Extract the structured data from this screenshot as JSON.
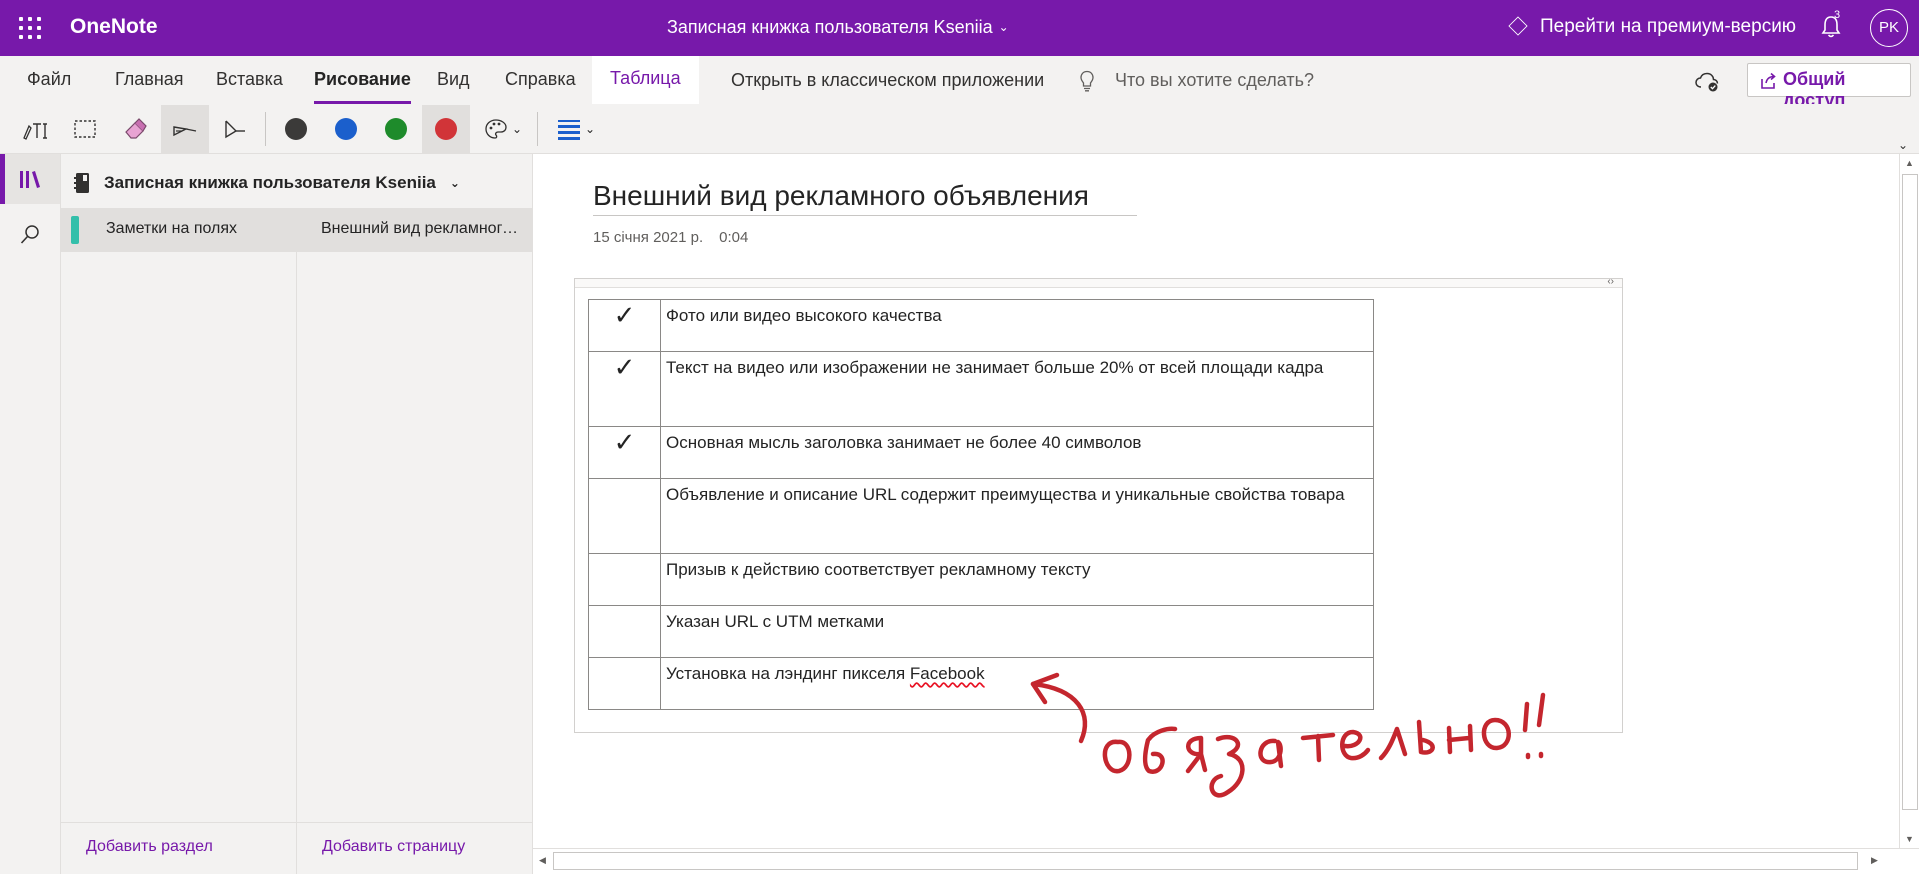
{
  "app": {
    "name": "OneNote",
    "notebook_title": "Записная книжка пользователя Kseniia",
    "premium_label": "Перейти на премиум-версию",
    "notifications_count": "3",
    "user_initials": "PK"
  },
  "ribbon": {
    "tabs": [
      {
        "label": "Файл"
      },
      {
        "label": "Главная"
      },
      {
        "label": "Вставка"
      },
      {
        "label": "Рисование"
      },
      {
        "label": "Вид"
      },
      {
        "label": "Справка"
      },
      {
        "label": "Таблица"
      }
    ],
    "active_tab": "Рисование",
    "open_in_desktop": "Открыть в классическом приложении",
    "tell_me_placeholder": "Что вы хотите сделать?",
    "share_label": "Общий доступ"
  },
  "draw_toolbar": {
    "tools": [
      {
        "icon": "ink-to-text-icon"
      },
      {
        "icon": "lasso-select-icon"
      },
      {
        "icon": "eraser-icon"
      },
      {
        "icon": "pen-icon",
        "selected": true
      },
      {
        "icon": "highlighter-icon"
      }
    ],
    "pen_colors": [
      "#3b3a39",
      "#1b5fcc",
      "#1e8b2b",
      "#d13438"
    ],
    "selected_pen_color": "#d13438",
    "more_colors_icon": "palette-icon",
    "thickness_icon": "line-thickness-icon"
  },
  "navigation": {
    "notebook": "Записная книжка пользователя Kseniia",
    "sections": [
      {
        "name": "Заметки на полях",
        "color": "#33bfaa",
        "selected": true
      }
    ],
    "pages": [
      {
        "title": "Внешний вид рекламного объявления",
        "selected": true
      }
    ],
    "add_section": "Добавить раздел",
    "add_page": "Добавить страницу"
  },
  "page": {
    "title": "Внешний вид рекламного объявления",
    "date": "15 січня 2021 р.",
    "time": "0:04",
    "checklist": [
      {
        "checked": true,
        "check_mark": "✓",
        "text": "Фото или видео высокого качества"
      },
      {
        "checked": true,
        "check_mark": "✓",
        "text": "Текст на видео или изображении не занимает больше 20% от всей площади кадра"
      },
      {
        "checked": true,
        "check_mark": "✓",
        "text": "Основная мысль заголовка занимает не более 40 символов"
      },
      {
        "checked": false,
        "check_mark": "",
        "text": "Объявление и описание URL содержит преимущества и уникальные свойства товара"
      },
      {
        "checked": false,
        "check_mark": "",
        "text": "Призыв к действию соответствует рекламному тексту"
      },
      {
        "checked": false,
        "check_mark": "",
        "text": "Указан URL с UTM метками"
      },
      {
        "checked": false,
        "check_mark": "",
        "text_before": "Установка на лэндинг пикселя ",
        "text_misspelled": "Facebook"
      }
    ],
    "ink_annotation": "обязательно!!",
    "ink_color": "#c4262e"
  }
}
